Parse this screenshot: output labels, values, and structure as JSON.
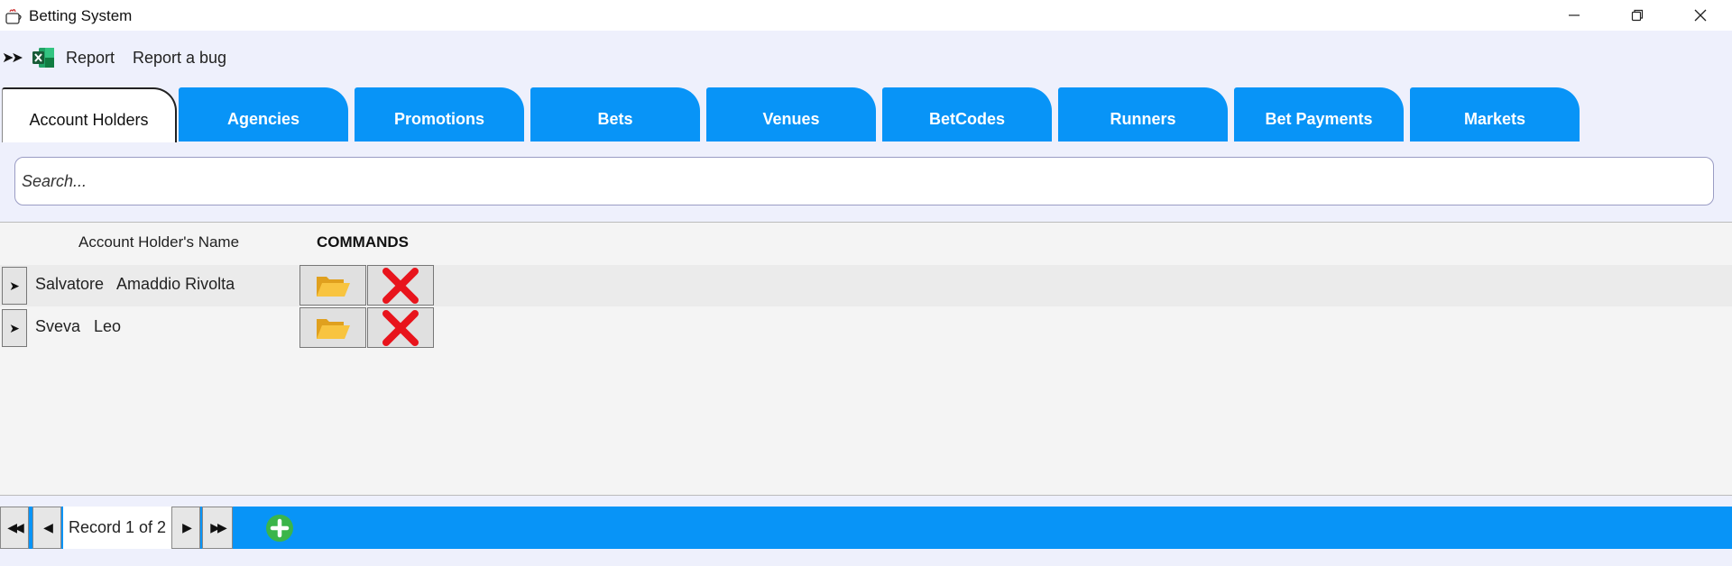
{
  "window": {
    "title": "Betting System",
    "controls": [
      "minimize-icon",
      "restore-icon",
      "close-icon"
    ]
  },
  "menu": {
    "items": [
      {
        "label": "Report",
        "icon": "excel-icon"
      },
      {
        "label": "Report a bug"
      }
    ]
  },
  "tabs": [
    {
      "label": "Account Holders",
      "active": true
    },
    {
      "label": "Agencies"
    },
    {
      "label": "Promotions"
    },
    {
      "label": "Bets"
    },
    {
      "label": "Venues"
    },
    {
      "label": "BetCodes"
    },
    {
      "label": "Runners"
    },
    {
      "label": "Bet Payments"
    },
    {
      "label": "Markets"
    }
  ],
  "search": {
    "placeholder": "Search...",
    "value": ""
  },
  "grid": {
    "columns": [
      "Account Holder's Name",
      "COMMANDS"
    ],
    "rows": [
      {
        "name": "Salvatore   Amaddio Rivolta"
      },
      {
        "name": "Sveva   Leo"
      }
    ],
    "commands": [
      "folder-open-icon",
      "delete-x-icon"
    ]
  },
  "navigator": {
    "record_text": "Record 1 of 2",
    "buttons": [
      "first-icon",
      "prev-icon",
      "next-icon",
      "last-icon",
      "add-icon"
    ]
  },
  "colors": {
    "accent": "#0894f7",
    "menubar_bg": "#eef0fc",
    "grid_bg": "#f4f4f4",
    "delete_red": "#e8141c",
    "folder_yellow": "#f3b32a",
    "add_green": "#3bb54a"
  }
}
